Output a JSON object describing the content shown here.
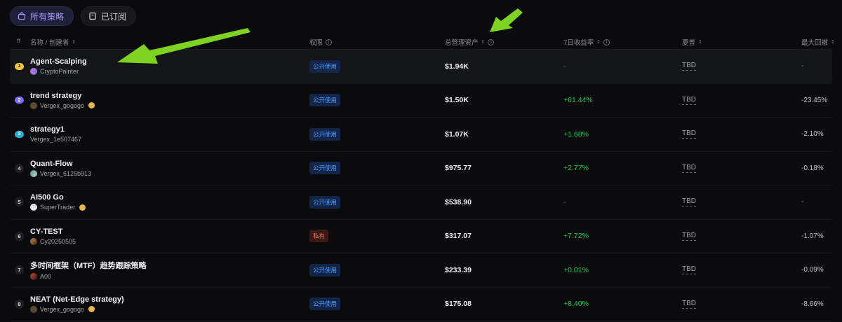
{
  "tabs": [
    {
      "label": "所有策略",
      "active": true,
      "icon": "bag-icon"
    },
    {
      "label": "已订阅",
      "active": false,
      "icon": "bookmark-icon"
    }
  ],
  "columns": {
    "index": "#",
    "name": "名称 / 创建者",
    "permission": "权限",
    "aum": "总管理资产",
    "return7d": "7日收益率",
    "sharpe": "夏普",
    "drawdown": "最大回撤"
  },
  "rows": [
    {
      "rank": "1",
      "name": "Agent-Scalping",
      "creator": "CryptoPainter",
      "permission": "公开使用",
      "aum": "$1.94K",
      "return7d": "-",
      "sharpe": "TBD",
      "drawdown": "-"
    },
    {
      "rank": "2",
      "name": "trend strategy",
      "creator": "Vergex_gogogo",
      "permission": "公开使用",
      "aum": "$1.50K",
      "return7d": "+61.44%",
      "sharpe": "TBD",
      "drawdown": "-23.45%"
    },
    {
      "rank": "3",
      "name": "strategy1",
      "creator": "Vergex_1e507467",
      "permission": "公开使用",
      "aum": "$1.07K",
      "return7d": "+1.68%",
      "sharpe": "TBD",
      "drawdown": "-2.10%"
    },
    {
      "rank": "4",
      "name": "Quant-Flow",
      "creator": "Vergex_6125b913",
      "permission": "公开使用",
      "aum": "$975.77",
      "return7d": "+2.77%",
      "sharpe": "TBD",
      "drawdown": "-0.18%"
    },
    {
      "rank": "5",
      "name": "AI500 Go",
      "creator": "SuperTrader",
      "permission": "公开使用",
      "aum": "$538.90",
      "return7d": "-",
      "sharpe": "TBD",
      "drawdown": "-"
    },
    {
      "rank": "6",
      "name": "CY-TEST",
      "creator": "Cy20250505",
      "permission": "私有",
      "aum": "$317.07",
      "return7d": "+7.72%",
      "sharpe": "TBD",
      "drawdown": "-1.07%"
    },
    {
      "rank": "7",
      "name": "多时间框架（MTF）趋势跟踪策略",
      "creator": "A00",
      "permission": "公开使用",
      "aum": "$233.39",
      "return7d": "+0.01%",
      "sharpe": "TBD",
      "drawdown": "-0.09%"
    },
    {
      "rank": "8",
      "name": "NEAT (Net-Edge strategy)",
      "creator": "Vergex_gogogo",
      "permission": "公开使用",
      "aum": "$175.08",
      "return7d": "+8.40%",
      "sharpe": "TBD",
      "drawdown": "-8.66%"
    }
  ],
  "colors": {
    "rank1": "#f5c542",
    "rank2": "#7c6cf6",
    "rank3": "#22b3d6",
    "positive": "#22c55e",
    "annotation_arrow": "#7ed321"
  }
}
